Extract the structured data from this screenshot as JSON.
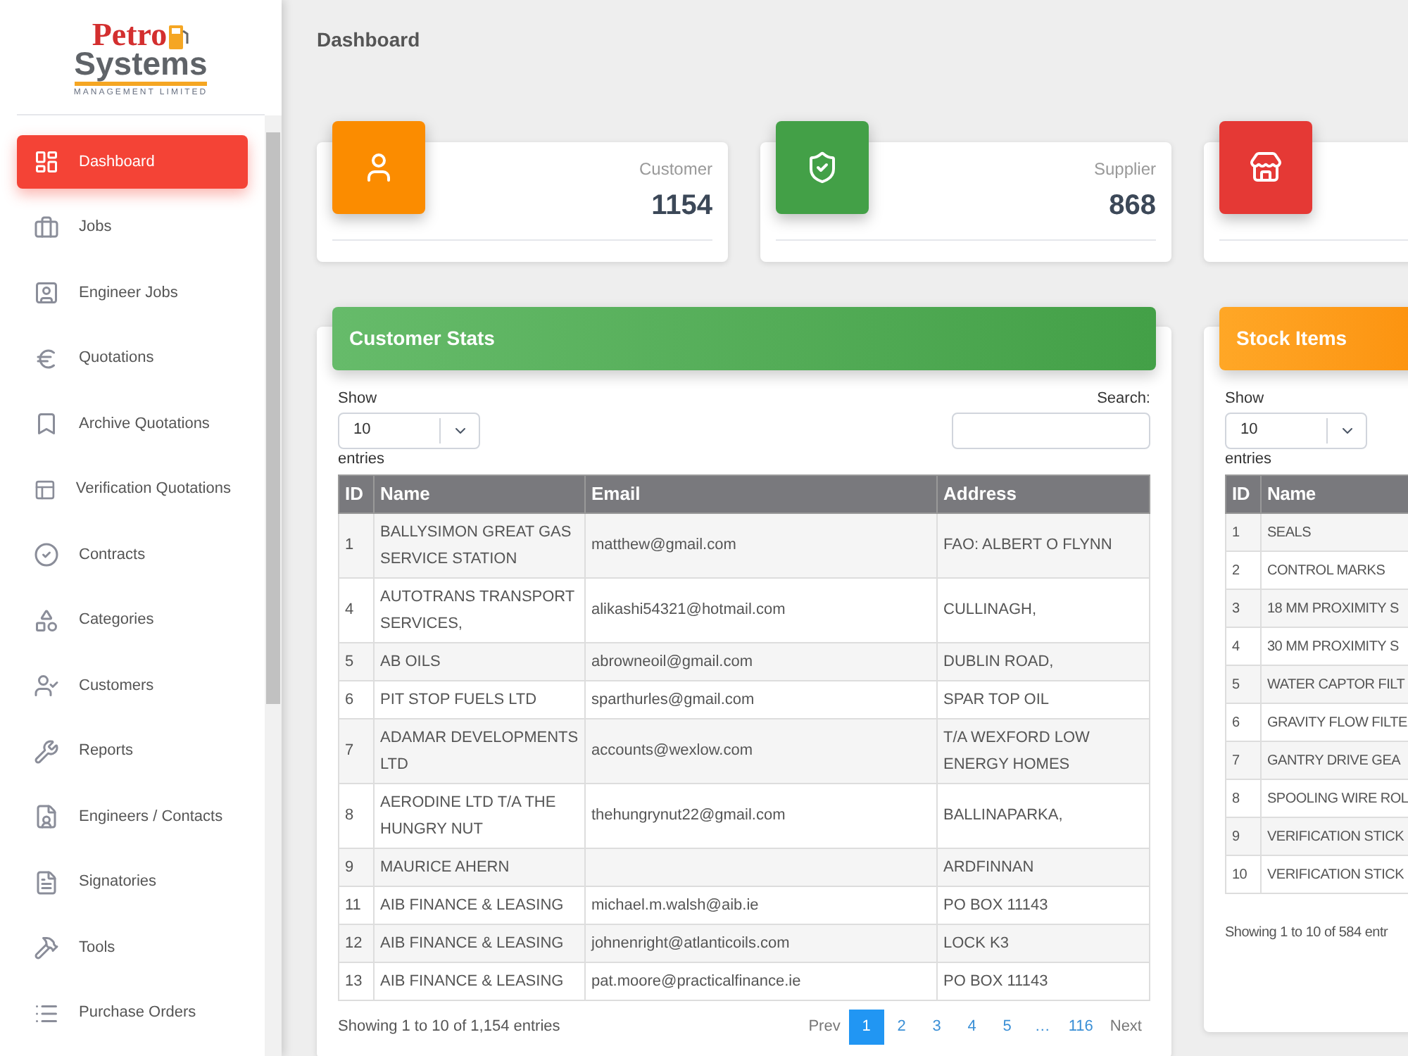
{
  "logo": {
    "word_1": "Petro",
    "word_2": "Systems",
    "tagline": "MANAGEMENT LIMITED"
  },
  "sidebar": {
    "items": [
      {
        "label": "Dashboard",
        "selected": true
      },
      {
        "label": "Jobs",
        "selected": false
      },
      {
        "label": "Engineer Jobs",
        "selected": false
      },
      {
        "label": "Quotations",
        "selected": false
      },
      {
        "label": "Archive Quotations",
        "selected": false
      },
      {
        "label": "Verification Quotations",
        "selected": false
      },
      {
        "label": "Contracts",
        "selected": false
      },
      {
        "label": "Categories",
        "selected": false
      },
      {
        "label": "Customers",
        "selected": false
      },
      {
        "label": "Reports",
        "selected": false
      },
      {
        "label": "Engineers / Contacts",
        "selected": false
      },
      {
        "label": "Signatories",
        "selected": false
      },
      {
        "label": "Tools",
        "selected": false
      },
      {
        "label": "Purchase Orders",
        "selected": false
      }
    ]
  },
  "page_title": "Dashboard",
  "stat_cards": [
    {
      "label": "Customer",
      "value": "1154",
      "color": "#fb8c00"
    },
    {
      "label": "Supplier",
      "value": "868",
      "color": "#43a047"
    },
    {
      "color": "#e53935"
    }
  ],
  "customer_stats": {
    "title": "Customer Stats",
    "show_label": "Show",
    "page_size": "10",
    "entries_label": "entries",
    "search_label": "Search:",
    "columns": [
      "ID",
      "Name",
      "Email",
      "Address"
    ],
    "rows": [
      [
        "1",
        "BALLYSIMON GREAT GAS SERVICE STATION",
        "matthew@gmail.com",
        "FAO: ALBERT O FLYNN"
      ],
      [
        "4",
        "AUTOTRANS TRANSPORT SERVICES,",
        "alikashi54321@hotmail.com",
        "CULLINAGH,"
      ],
      [
        "5",
        "AB OILS",
        "abrowneoil@gmail.com",
        "DUBLIN ROAD,"
      ],
      [
        "6",
        "PIT STOP FUELS LTD",
        "sparthurles@gmail.com",
        "SPAR TOP OIL"
      ],
      [
        "7",
        "ADAMAR DEVELOPMENTS LTD",
        "accounts@wexlow.com",
        "T/A WEXFORD LOW ENERGY HOMES"
      ],
      [
        "8",
        "AERODINE LTD T/A THE HUNGRY NUT",
        "thehungrynut22@gmail.com",
        "BALLINAPARKA,"
      ],
      [
        "9",
        "MAURICE AHERN",
        "",
        "ARDFINNAN"
      ],
      [
        "11",
        "AIB FINANCE & LEASING",
        "michael.m.walsh@aib.ie",
        "PO BOX 11143"
      ],
      [
        "12",
        "AIB FINANCE & LEASING",
        "johnenright@atlanticoils.com",
        "LOCK K3"
      ],
      [
        "13",
        "AIB FINANCE & LEASING",
        "pat.moore@practicalfinance.ie",
        "PO BOX 11143"
      ]
    ],
    "info": "Showing 1 to 10 of 1,154 entries",
    "pagination": [
      {
        "label": "Prev",
        "selected": false
      },
      {
        "label": "1",
        "selected": true
      },
      {
        "label": "2",
        "selected": false
      },
      {
        "label": "3",
        "selected": false
      },
      {
        "label": "4",
        "selected": false
      },
      {
        "label": "5",
        "selected": false
      },
      {
        "label": "…",
        "selected": false
      },
      {
        "label": "116",
        "selected": false
      },
      {
        "label": "Next",
        "selected": false
      }
    ]
  },
  "stock_items": {
    "title": "Stock Items",
    "show_label": "Show",
    "page_size": "10",
    "entries_label": "entries",
    "columns": [
      "ID",
      "Name"
    ],
    "rows": [
      [
        "1",
        "SEALS"
      ],
      [
        "2",
        "CONTROL MARKS"
      ],
      [
        "3",
        "18 MM PROXIMITY S"
      ],
      [
        "4",
        "30 MM PROXIMITY S"
      ],
      [
        "5",
        "WATER CAPTOR FILT"
      ],
      [
        "6",
        "GRAVITY FLOW FILTE"
      ],
      [
        "7",
        "GANTRY DRIVE GEA"
      ],
      [
        "8",
        "SPOOLING WIRE ROL"
      ],
      [
        "9",
        "VERIFICATION STICK"
      ],
      [
        "10",
        "VERIFICATION STICK"
      ]
    ],
    "info": "Showing 1 to 10 of 584 entr"
  }
}
